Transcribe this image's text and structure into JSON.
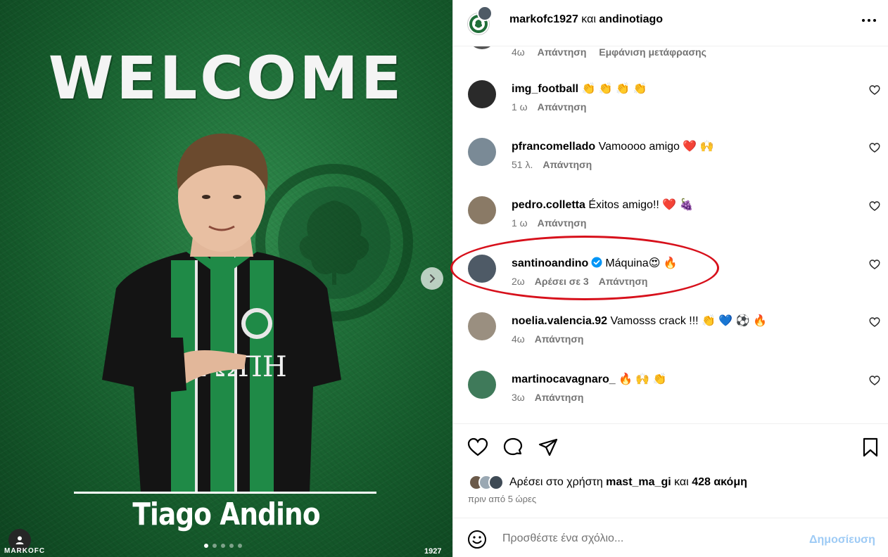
{
  "media": {
    "headline": "WELCOME",
    "player_name": "Tiago Andino",
    "brand": "MARKOFC",
    "year": "1927",
    "carousel": {
      "count": 5,
      "active": 0
    }
  },
  "header": {
    "owner": "markofc1927",
    "conjunction": "και",
    "collaborator": "andinotiago"
  },
  "top_partial": {
    "time": "4ω",
    "reply": "Απάντηση",
    "translate": "Εμφάνιση μετάφρασης"
  },
  "comments": [
    {
      "user": "img_football",
      "text": "👏 👏 👏 👏",
      "time": "1 ω",
      "reply": "Απάντηση",
      "likes": "",
      "verified": false,
      "avatar_color": "#2a2a2a"
    },
    {
      "user": "pfrancomellado",
      "text": "Vamoooo amigo ❤️ 🙌",
      "time": "51 λ.",
      "reply": "Απάντηση",
      "likes": "",
      "verified": false,
      "avatar_color": "#7a8a96"
    },
    {
      "user": "pedro.colletta",
      "text": "Éxitos amigo!! ❤️ 🍇",
      "time": "1 ω",
      "reply": "Απάντηση",
      "likes": "",
      "verified": false,
      "avatar_color": "#8a7a66"
    },
    {
      "user": "santinoandino",
      "text": "Máquina😍 🔥",
      "time": "2ω",
      "reply": "Απάντηση",
      "likes": "Αρέσει σε 3",
      "verified": true,
      "avatar_color": "#4e5a66"
    },
    {
      "user": "noelia.valencia.92",
      "text": "Vamosss crack !!! 👏 💙 ⚽ 🔥",
      "time": "4ω",
      "reply": "Απάντηση",
      "likes": "",
      "verified": false,
      "avatar_color": "#9a8f80"
    },
    {
      "user": "martinocavagnaro_",
      "text": "🔥 🙌 👏",
      "time": "3ω",
      "reply": "Απάντηση",
      "likes": "",
      "verified": false,
      "avatar_color": "#3f7a5a"
    }
  ],
  "likes": {
    "prefix": "Αρέσει στο χρήστη",
    "user": "mast_ma_gi",
    "conjunction": "και",
    "others": "428 ακόμη",
    "time": "πριν από 5 ώρες"
  },
  "composer": {
    "placeholder": "Προσθέστε ένα σχόλιο...",
    "post_label": "Δημοσίευση"
  },
  "colors": {
    "media_green": "#1f6e38",
    "highlight_ring": "#d7101b",
    "muted_text": "#737373",
    "post_button_disabled": "#9ecbf5",
    "verified": "#0095f6"
  }
}
